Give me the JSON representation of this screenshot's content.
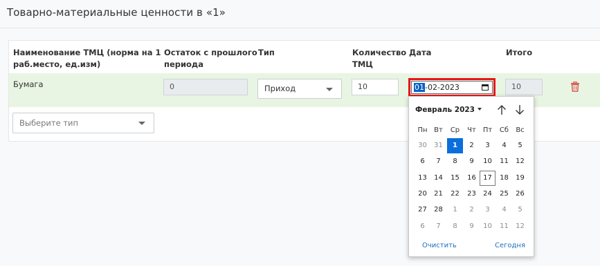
{
  "page": {
    "title": "Товарно-материальные ценности в «1»"
  },
  "table": {
    "headers": {
      "name": [
        "Наименование ТМЦ (норма на 1",
        "раб.место, ед.изм)"
      ],
      "remainder": [
        "Остаток с прошлого",
        "периода"
      ],
      "type": [
        "Тип"
      ],
      "quantity": [
        "Количество",
        "ТМЦ"
      ],
      "date": [
        "Дата"
      ],
      "total": [
        "Итого"
      ]
    },
    "row": {
      "name": "Бумага",
      "remainder": "0",
      "type": "Приход",
      "quantity": "10",
      "date_day": "01",
      "date_rest": "-02-2023",
      "total": "10"
    },
    "add_type_placeholder": "Выберите тип"
  },
  "datepicker": {
    "month_label": "Февраль 2023",
    "weekdays": [
      "Пн",
      "Вт",
      "Ср",
      "Чт",
      "Пт",
      "Сб",
      "Вс"
    ],
    "weeks": [
      [
        "30",
        "31",
        "1",
        "2",
        "3",
        "4",
        "5"
      ],
      [
        "6",
        "7",
        "8",
        "9",
        "10",
        "11",
        "12"
      ],
      [
        "13",
        "14",
        "15",
        "16",
        "17",
        "18",
        "19"
      ],
      [
        "20",
        "21",
        "22",
        "23",
        "24",
        "25",
        "26"
      ],
      [
        "27",
        "28",
        "1",
        "2",
        "3",
        "4",
        "5"
      ],
      [
        "6",
        "7",
        "8",
        "9",
        "10",
        "11",
        "12"
      ]
    ],
    "other_month": [
      [
        0,
        0
      ],
      [
        0,
        1
      ],
      [
        4,
        2
      ],
      [
        4,
        3
      ],
      [
        4,
        4
      ],
      [
        4,
        5
      ],
      [
        4,
        6
      ],
      [
        5,
        0
      ],
      [
        5,
        1
      ],
      [
        5,
        2
      ],
      [
        5,
        3
      ],
      [
        5,
        4
      ],
      [
        5,
        5
      ],
      [
        5,
        6
      ]
    ],
    "selected": [
      0,
      2
    ],
    "today": [
      2,
      4
    ],
    "clear_label": "Очистить",
    "today_label": "Сегодня"
  },
  "colors": {
    "accent": "#0a6fdc",
    "highlight_border": "#e8141b",
    "row_bg": "#e8f5e3",
    "trash": "#d9534f"
  }
}
